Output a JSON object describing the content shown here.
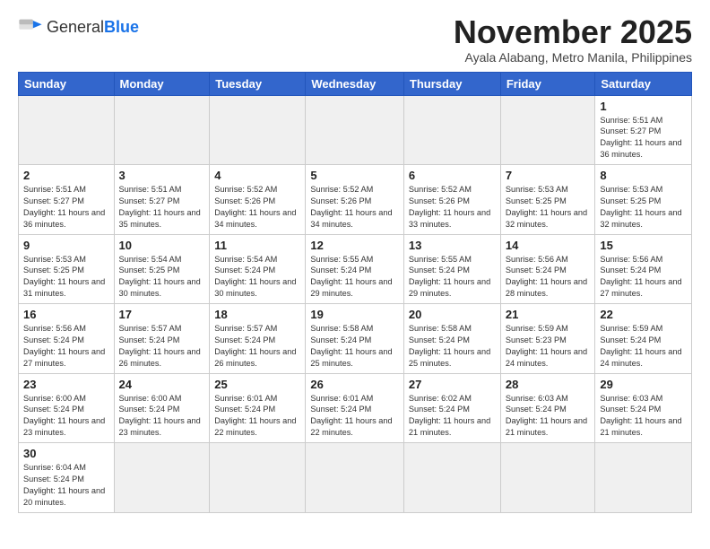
{
  "logo": {
    "text_general": "General",
    "text_blue": "Blue"
  },
  "header": {
    "month_title": "November 2025",
    "subtitle": "Ayala Alabang, Metro Manila, Philippines"
  },
  "weekdays": [
    "Sunday",
    "Monday",
    "Tuesday",
    "Wednesday",
    "Thursday",
    "Friday",
    "Saturday"
  ],
  "days": {
    "d1": {
      "num": "1",
      "sunrise": "Sunrise: 5:51 AM",
      "sunset": "Sunset: 5:27 PM",
      "daylight": "Daylight: 11 hours and 36 minutes."
    },
    "d2": {
      "num": "2",
      "sunrise": "Sunrise: 5:51 AM",
      "sunset": "Sunset: 5:27 PM",
      "daylight": "Daylight: 11 hours and 36 minutes."
    },
    "d3": {
      "num": "3",
      "sunrise": "Sunrise: 5:51 AM",
      "sunset": "Sunset: 5:27 PM",
      "daylight": "Daylight: 11 hours and 35 minutes."
    },
    "d4": {
      "num": "4",
      "sunrise": "Sunrise: 5:52 AM",
      "sunset": "Sunset: 5:26 PM",
      "daylight": "Daylight: 11 hours and 34 minutes."
    },
    "d5": {
      "num": "5",
      "sunrise": "Sunrise: 5:52 AM",
      "sunset": "Sunset: 5:26 PM",
      "daylight": "Daylight: 11 hours and 34 minutes."
    },
    "d6": {
      "num": "6",
      "sunrise": "Sunrise: 5:52 AM",
      "sunset": "Sunset: 5:26 PM",
      "daylight": "Daylight: 11 hours and 33 minutes."
    },
    "d7": {
      "num": "7",
      "sunrise": "Sunrise: 5:53 AM",
      "sunset": "Sunset: 5:25 PM",
      "daylight": "Daylight: 11 hours and 32 minutes."
    },
    "d8": {
      "num": "8",
      "sunrise": "Sunrise: 5:53 AM",
      "sunset": "Sunset: 5:25 PM",
      "daylight": "Daylight: 11 hours and 32 minutes."
    },
    "d9": {
      "num": "9",
      "sunrise": "Sunrise: 5:53 AM",
      "sunset": "Sunset: 5:25 PM",
      "daylight": "Daylight: 11 hours and 31 minutes."
    },
    "d10": {
      "num": "10",
      "sunrise": "Sunrise: 5:54 AM",
      "sunset": "Sunset: 5:25 PM",
      "daylight": "Daylight: 11 hours and 30 minutes."
    },
    "d11": {
      "num": "11",
      "sunrise": "Sunrise: 5:54 AM",
      "sunset": "Sunset: 5:24 PM",
      "daylight": "Daylight: 11 hours and 30 minutes."
    },
    "d12": {
      "num": "12",
      "sunrise": "Sunrise: 5:55 AM",
      "sunset": "Sunset: 5:24 PM",
      "daylight": "Daylight: 11 hours and 29 minutes."
    },
    "d13": {
      "num": "13",
      "sunrise": "Sunrise: 5:55 AM",
      "sunset": "Sunset: 5:24 PM",
      "daylight": "Daylight: 11 hours and 29 minutes."
    },
    "d14": {
      "num": "14",
      "sunrise": "Sunrise: 5:56 AM",
      "sunset": "Sunset: 5:24 PM",
      "daylight": "Daylight: 11 hours and 28 minutes."
    },
    "d15": {
      "num": "15",
      "sunrise": "Sunrise: 5:56 AM",
      "sunset": "Sunset: 5:24 PM",
      "daylight": "Daylight: 11 hours and 27 minutes."
    },
    "d16": {
      "num": "16",
      "sunrise": "Sunrise: 5:56 AM",
      "sunset": "Sunset: 5:24 PM",
      "daylight": "Daylight: 11 hours and 27 minutes."
    },
    "d17": {
      "num": "17",
      "sunrise": "Sunrise: 5:57 AM",
      "sunset": "Sunset: 5:24 PM",
      "daylight": "Daylight: 11 hours and 26 minutes."
    },
    "d18": {
      "num": "18",
      "sunrise": "Sunrise: 5:57 AM",
      "sunset": "Sunset: 5:24 PM",
      "daylight": "Daylight: 11 hours and 26 minutes."
    },
    "d19": {
      "num": "19",
      "sunrise": "Sunrise: 5:58 AM",
      "sunset": "Sunset: 5:24 PM",
      "daylight": "Daylight: 11 hours and 25 minutes."
    },
    "d20": {
      "num": "20",
      "sunrise": "Sunrise: 5:58 AM",
      "sunset": "Sunset: 5:24 PM",
      "daylight": "Daylight: 11 hours and 25 minutes."
    },
    "d21": {
      "num": "21",
      "sunrise": "Sunrise: 5:59 AM",
      "sunset": "Sunset: 5:23 PM",
      "daylight": "Daylight: 11 hours and 24 minutes."
    },
    "d22": {
      "num": "22",
      "sunrise": "Sunrise: 5:59 AM",
      "sunset": "Sunset: 5:24 PM",
      "daylight": "Daylight: 11 hours and 24 minutes."
    },
    "d23": {
      "num": "23",
      "sunrise": "Sunrise: 6:00 AM",
      "sunset": "Sunset: 5:24 PM",
      "daylight": "Daylight: 11 hours and 23 minutes."
    },
    "d24": {
      "num": "24",
      "sunrise": "Sunrise: 6:00 AM",
      "sunset": "Sunset: 5:24 PM",
      "daylight": "Daylight: 11 hours and 23 minutes."
    },
    "d25": {
      "num": "25",
      "sunrise": "Sunrise: 6:01 AM",
      "sunset": "Sunset: 5:24 PM",
      "daylight": "Daylight: 11 hours and 22 minutes."
    },
    "d26": {
      "num": "26",
      "sunrise": "Sunrise: 6:01 AM",
      "sunset": "Sunset: 5:24 PM",
      "daylight": "Daylight: 11 hours and 22 minutes."
    },
    "d27": {
      "num": "27",
      "sunrise": "Sunrise: 6:02 AM",
      "sunset": "Sunset: 5:24 PM",
      "daylight": "Daylight: 11 hours and 21 minutes."
    },
    "d28": {
      "num": "28",
      "sunrise": "Sunrise: 6:03 AM",
      "sunset": "Sunset: 5:24 PM",
      "daylight": "Daylight: 11 hours and 21 minutes."
    },
    "d29": {
      "num": "29",
      "sunrise": "Sunrise: 6:03 AM",
      "sunset": "Sunset: 5:24 PM",
      "daylight": "Daylight: 11 hours and 21 minutes."
    },
    "d30": {
      "num": "30",
      "sunrise": "Sunrise: 6:04 AM",
      "sunset": "Sunset: 5:24 PM",
      "daylight": "Daylight: 11 hours and 20 minutes."
    }
  }
}
